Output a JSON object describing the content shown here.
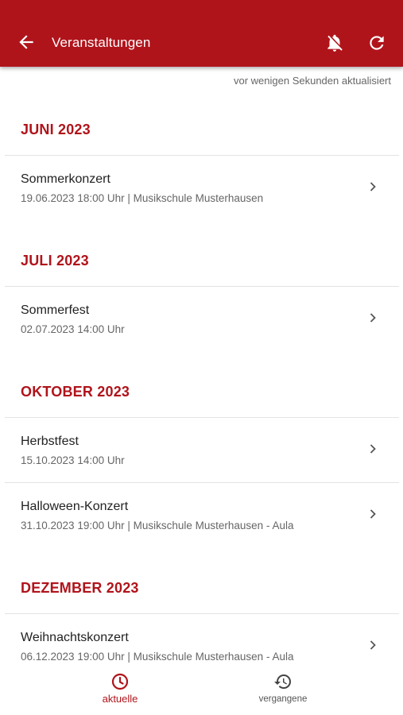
{
  "header": {
    "title": "Veranstaltungen",
    "icons": {
      "back": "arrow-back-icon",
      "notifications": "bell-off-icon",
      "refresh": "refresh-icon"
    }
  },
  "updated_text": "vor wenigen Sekunden aktualisiert",
  "months": [
    {
      "label": "JUNI 2023"
    },
    {
      "label": "JULI 2023"
    },
    {
      "label": "OKTOBER 2023"
    },
    {
      "label": "DEZEMBER 2023"
    }
  ],
  "events": [
    {
      "name": "Sommerkonzert",
      "meta": "19.06.2023 18:00 Uhr | Musikschule Musterhausen"
    },
    {
      "name": "Sommerfest",
      "meta": "02.07.2023 14:00 Uhr"
    },
    {
      "name": "Herbstfest",
      "meta": "15.10.2023 14:00 Uhr"
    },
    {
      "name": "Halloween-Konzert",
      "meta": "31.10.2023 19:00 Uhr | Musikschule Musterhausen - Aula"
    },
    {
      "name": "Weihnachtskonzert",
      "meta": "06.12.2023 19:00 Uhr | Musikschule Musterhausen - Aula"
    }
  ],
  "bottom_nav": {
    "current": {
      "label": "aktuelle",
      "icon": "clock-icon",
      "active": true
    },
    "past": {
      "label": "vergangene",
      "icon": "history-icon",
      "active": false
    }
  },
  "colors": {
    "primary": "#b0141b",
    "text": "#222222",
    "secondary_text": "#666666",
    "divider": "#e3e3e3"
  }
}
